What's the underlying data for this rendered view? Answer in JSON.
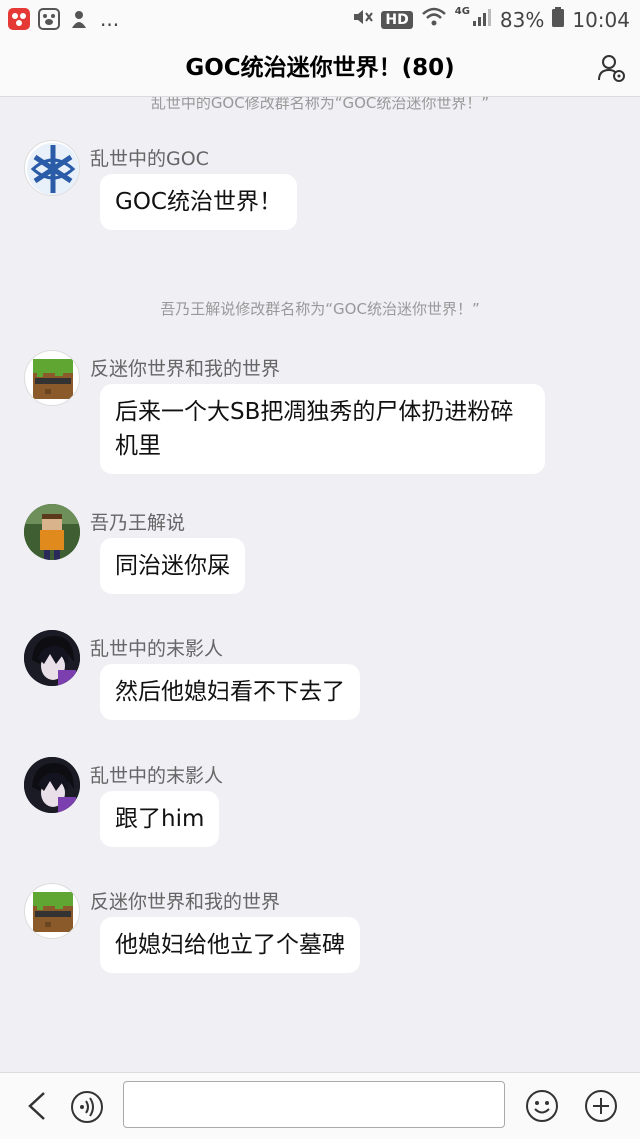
{
  "status": {
    "dots": "...",
    "hd": "HD",
    "network": "4G",
    "battery": "83%",
    "time": "10:04"
  },
  "header": {
    "title": "GOC统治迷你世界！(80)"
  },
  "chat": {
    "sys_notes": [
      "乱世中的GOC修改群名称为“GOC统治迷你世界！”",
      "吾乃王解说修改群名称为“GOC统治迷你世界！”"
    ],
    "messages": [
      {
        "sender": "乱世中的GOC",
        "text": "GOC统治世界！",
        "avatar": "network-logo"
      },
      {
        "sender": "反迷你世界和我的世界",
        "text": "后来一个大SB把凋独秀的尸体扔进粉碎机里",
        "avatar": "minecraft-grass-block"
      },
      {
        "sender": "吾乃王解说",
        "text": "同治迷你屎",
        "avatar": "minecraft-character"
      },
      {
        "sender": "乱世中的末影人",
        "text": "然后他媳妇看不下去了",
        "avatar": "anime-dark-hair"
      },
      {
        "sender": "乱世中的末影人",
        "text": "跟了him",
        "avatar": "anime-dark-hair"
      },
      {
        "sender": "反迷你世界和我的世界",
        "text": "他媳妇给他立了个墓碑",
        "avatar": "minecraft-grass-block"
      }
    ]
  },
  "input": {
    "placeholder": ""
  }
}
